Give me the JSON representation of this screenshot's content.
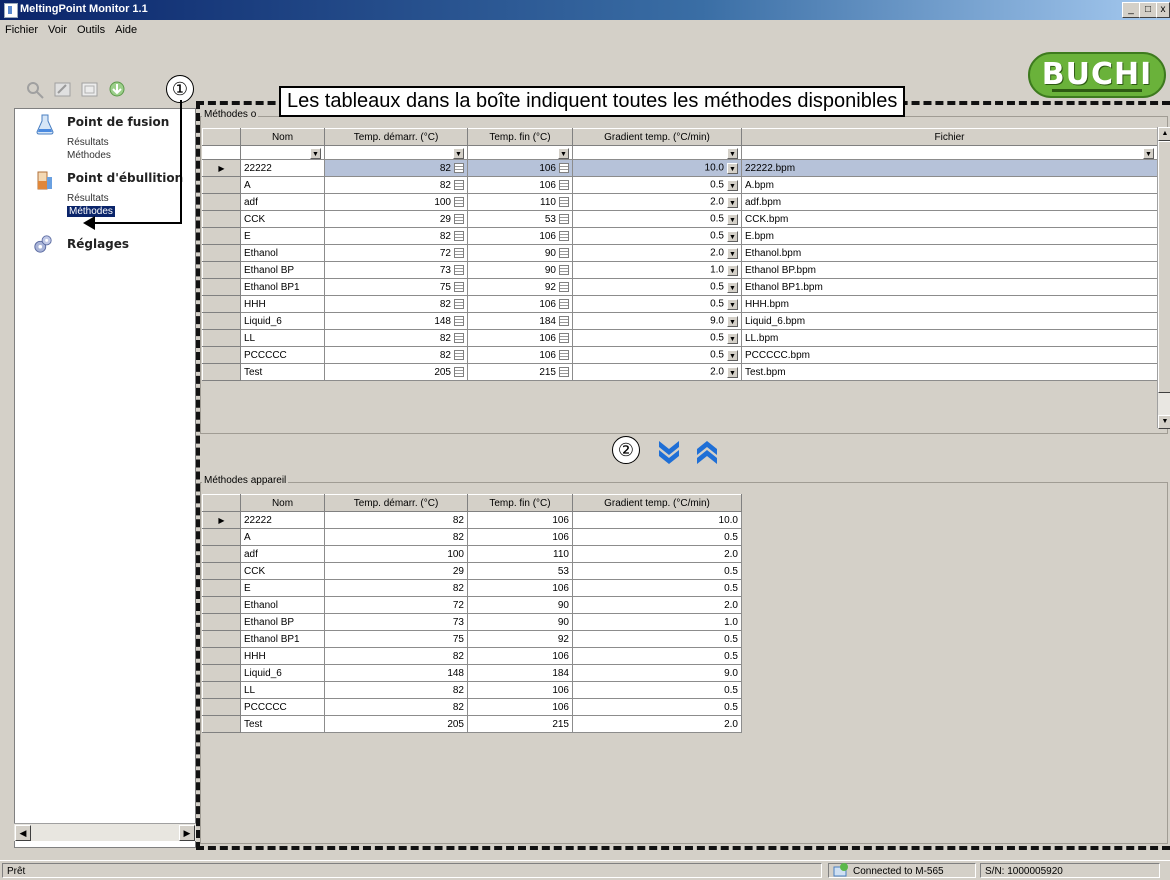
{
  "window": {
    "title": "MeltingPoint Monitor 1.1",
    "minimize": "_",
    "maximize": "□",
    "close": "x"
  },
  "menu": [
    "Fichier",
    "Voir",
    "Outils",
    "Aide"
  ],
  "toolbar_icons": [
    "zoom-icon",
    "edit-icon",
    "export-icon",
    "download-icon"
  ],
  "logo": {
    "text": "BUCHI"
  },
  "nav": {
    "fusion": {
      "title": "Point de fusion",
      "items": [
        "Résultats",
        "Méthodes"
      ]
    },
    "ebullition": {
      "title": "Point d'ébullition",
      "items": [
        "Résultats",
        "Méthodes"
      ]
    },
    "settings": {
      "title": "Réglages"
    }
  },
  "annotations": {
    "callout": "Les tableaux dans la boîte indiquent toutes les méthodes disponibles",
    "marker1": "①",
    "marker2": "②"
  },
  "top_group": {
    "title": "Méthodes o",
    "columns": [
      "Nom",
      "Temp. démarr. (°C)",
      "Temp. fin (°C)",
      "Gradient temp. (°C/min)",
      "Fichier"
    ],
    "rows": [
      {
        "name": "22222",
        "start": "82",
        "end": "106",
        "grad": "10.0",
        "file": "22222.bpm"
      },
      {
        "name": "A",
        "start": "82",
        "end": "106",
        "grad": "0.5",
        "file": "A.bpm"
      },
      {
        "name": "adf",
        "start": "100",
        "end": "110",
        "grad": "2.0",
        "file": "adf.bpm"
      },
      {
        "name": "CCK",
        "start": "29",
        "end": "53",
        "grad": "0.5",
        "file": "CCK.bpm"
      },
      {
        "name": "E",
        "start": "82",
        "end": "106",
        "grad": "0.5",
        "file": "E.bpm"
      },
      {
        "name": "Ethanol",
        "start": "72",
        "end": "90",
        "grad": "2.0",
        "file": "Ethanol.bpm"
      },
      {
        "name": "Ethanol BP",
        "start": "73",
        "end": "90",
        "grad": "1.0",
        "file": "Ethanol BP.bpm"
      },
      {
        "name": "Ethanol BP1",
        "start": "75",
        "end": "92",
        "grad": "0.5",
        "file": "Ethanol BP1.bpm"
      },
      {
        "name": "HHH",
        "start": "82",
        "end": "106",
        "grad": "0.5",
        "file": "HHH.bpm"
      },
      {
        "name": "Liquid_6",
        "start": "148",
        "end": "184",
        "grad": "9.0",
        "file": "Liquid_6.bpm"
      },
      {
        "name": "LL",
        "start": "82",
        "end": "106",
        "grad": "0.5",
        "file": "LL.bpm"
      },
      {
        "name": "PCCCCC",
        "start": "82",
        "end": "106",
        "grad": "0.5",
        "file": "PCCCCC.bpm"
      },
      {
        "name": "Test",
        "start": "205",
        "end": "215",
        "grad": "2.0",
        "file": "Test.bpm"
      }
    ]
  },
  "device_group": {
    "title": "Méthodes appareil",
    "columns": [
      "Nom",
      "Temp. démarr. (°C)",
      "Temp. fin (°C)",
      "Gradient temp. (°C/min)"
    ],
    "rows": [
      {
        "name": "22222",
        "start": "82",
        "end": "106",
        "grad": "10.0"
      },
      {
        "name": "A",
        "start": "82",
        "end": "106",
        "grad": "0.5"
      },
      {
        "name": "adf",
        "start": "100",
        "end": "110",
        "grad": "2.0"
      },
      {
        "name": "CCK",
        "start": "29",
        "end": "53",
        "grad": "0.5"
      },
      {
        "name": "E",
        "start": "82",
        "end": "106",
        "grad": "0.5"
      },
      {
        "name": "Ethanol",
        "start": "72",
        "end": "90",
        "grad": "2.0"
      },
      {
        "name": "Ethanol BP",
        "start": "73",
        "end": "90",
        "grad": "1.0"
      },
      {
        "name": "Ethanol BP1",
        "start": "75",
        "end": "92",
        "grad": "0.5"
      },
      {
        "name": "HHH",
        "start": "82",
        "end": "106",
        "grad": "0.5"
      },
      {
        "name": "Liquid_6",
        "start": "148",
        "end": "184",
        "grad": "9.0"
      },
      {
        "name": "LL",
        "start": "82",
        "end": "106",
        "grad": "0.5"
      },
      {
        "name": "PCCCCC",
        "start": "82",
        "end": "106",
        "grad": "0.5"
      },
      {
        "name": "Test",
        "start": "205",
        "end": "215",
        "grad": "2.0"
      }
    ]
  },
  "status": {
    "left": "Prêt",
    "connection": "Connected to M-565",
    "serial": "S/N: 1000005920"
  },
  "colors": {
    "accent_blue": "#1f6fd6",
    "logo_green": "#6ab23a",
    "selected_row": "#b6c2d9"
  }
}
